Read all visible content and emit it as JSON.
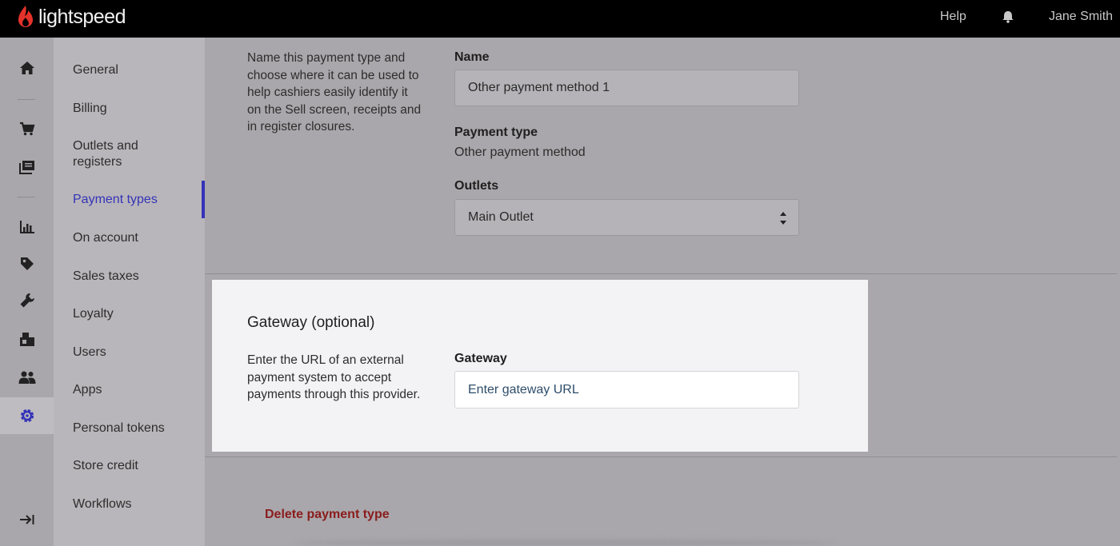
{
  "topbar": {
    "brand": "lightspeed",
    "help": "Help",
    "user": "Jane Smith",
    "icons": [
      "flame-logo-icon",
      "bell-icon"
    ]
  },
  "rail": {
    "items": [
      "home-icon",
      "cart-icon",
      "catalog-icon",
      "reports-icon",
      "tag-icon",
      "wrench-icon",
      "inventory-icon",
      "customers-icon",
      "gear-icon"
    ],
    "active": "gear-icon",
    "collapse_icon": "collapse-icon"
  },
  "sidebar": {
    "items": [
      {
        "label": "General"
      },
      {
        "label": "Billing"
      },
      {
        "label": "Outlets and registers"
      },
      {
        "label": "Payment types"
      },
      {
        "label": "On account"
      },
      {
        "label": "Sales taxes"
      },
      {
        "label": "Loyalty"
      },
      {
        "label": "Users"
      },
      {
        "label": "Apps"
      },
      {
        "label": "Personal tokens"
      },
      {
        "label": "Store credit"
      },
      {
        "label": "Workflows"
      }
    ],
    "active": "Payment types"
  },
  "details": {
    "description": "Name this payment type and choose where it can be used to help cashiers easily identify it on the Sell screen, receipts and in register closures.",
    "name_label": "Name",
    "name_value": "Other payment method 1",
    "type_label": "Payment type",
    "type_value": "Other payment method",
    "outlets_label": "Outlets",
    "outlets_value": "Main Outlet"
  },
  "gateway": {
    "title": "Gateway (optional)",
    "description": "Enter the URL of an external payment system to accept payments through this provider.",
    "label": "Gateway",
    "placeholder": "Enter gateway URL"
  },
  "actions": {
    "delete": "Delete payment type"
  },
  "colors": {
    "accent": "#3533b8",
    "brand_red": "#e4322b",
    "danger": "#8a1c1c",
    "topbar": "#000000"
  }
}
